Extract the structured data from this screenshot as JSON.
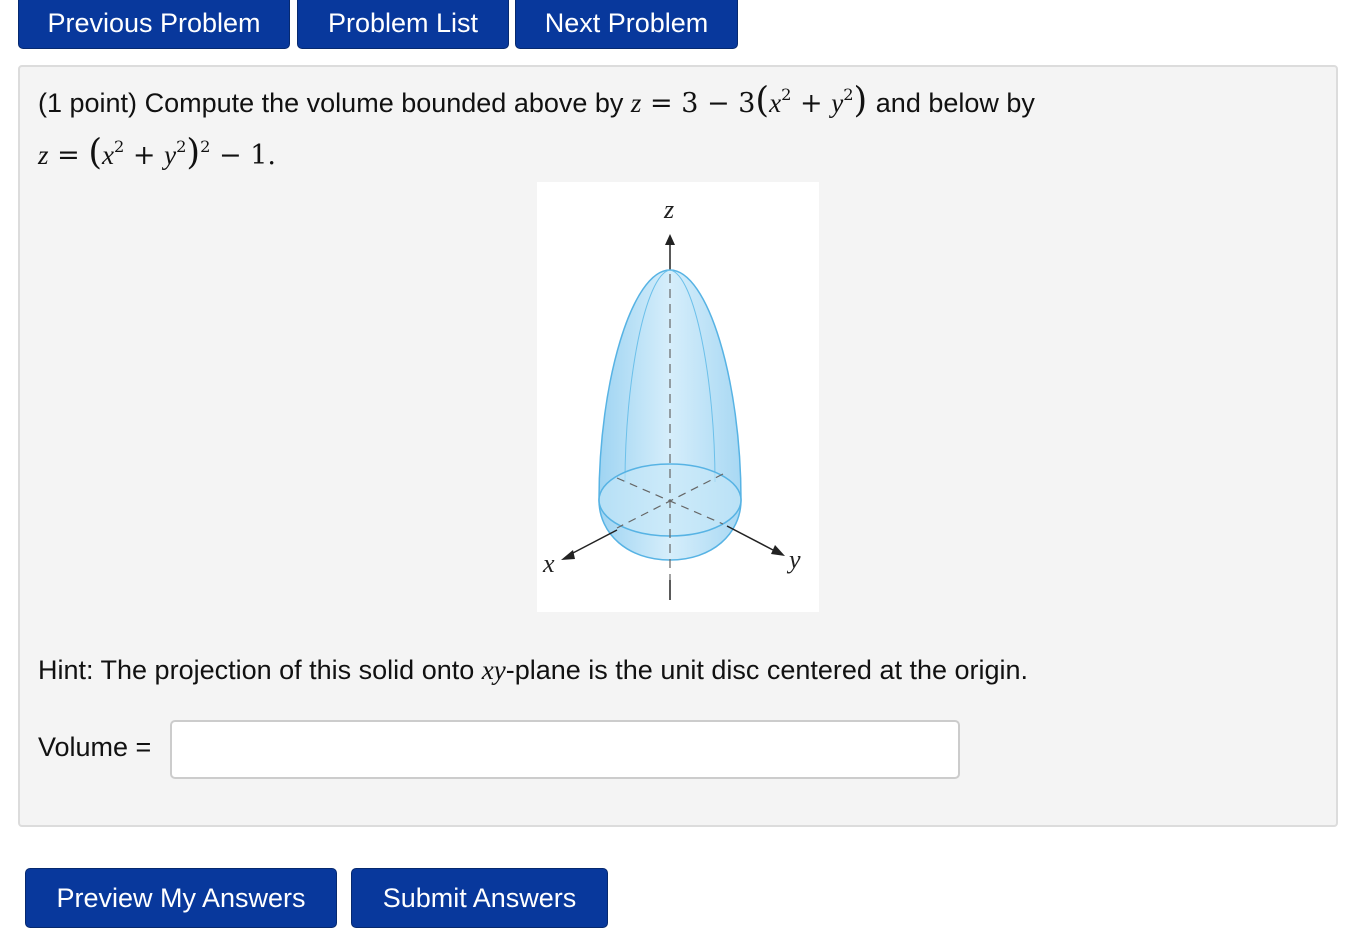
{
  "nav": {
    "previous": "Previous Problem",
    "list": "Problem List",
    "next": "Next Problem"
  },
  "problem": {
    "points": "(1 point)",
    "statement_a": "Compute the volume bounded above by",
    "upper_surface": {
      "lhs": "z",
      "eq": "=",
      "rhs_a": "3 − 3",
      "x": "x",
      "plus": "+",
      "y": "y",
      "exp": "2"
    },
    "statement_b": "and below by",
    "lower_surface": {
      "lhs": "z",
      "eq": "=",
      "x": "x",
      "plus": "+",
      "y": "y",
      "exp": "2",
      "tail": "− 1."
    }
  },
  "figure": {
    "axis_z": "z",
    "axis_x": "x",
    "axis_y": "y",
    "fill_color": "#bfe3f7",
    "edge_color": "#57b3e4"
  },
  "hint": {
    "prefix": "Hint: The projection of this solid onto",
    "plane": "xy",
    "suffix": "-plane is the unit disc centered at the origin."
  },
  "answer": {
    "label": "Volume =",
    "value": "",
    "placeholder": ""
  },
  "actions": {
    "preview": "Preview My Answers",
    "submit": "Submit Answers"
  }
}
